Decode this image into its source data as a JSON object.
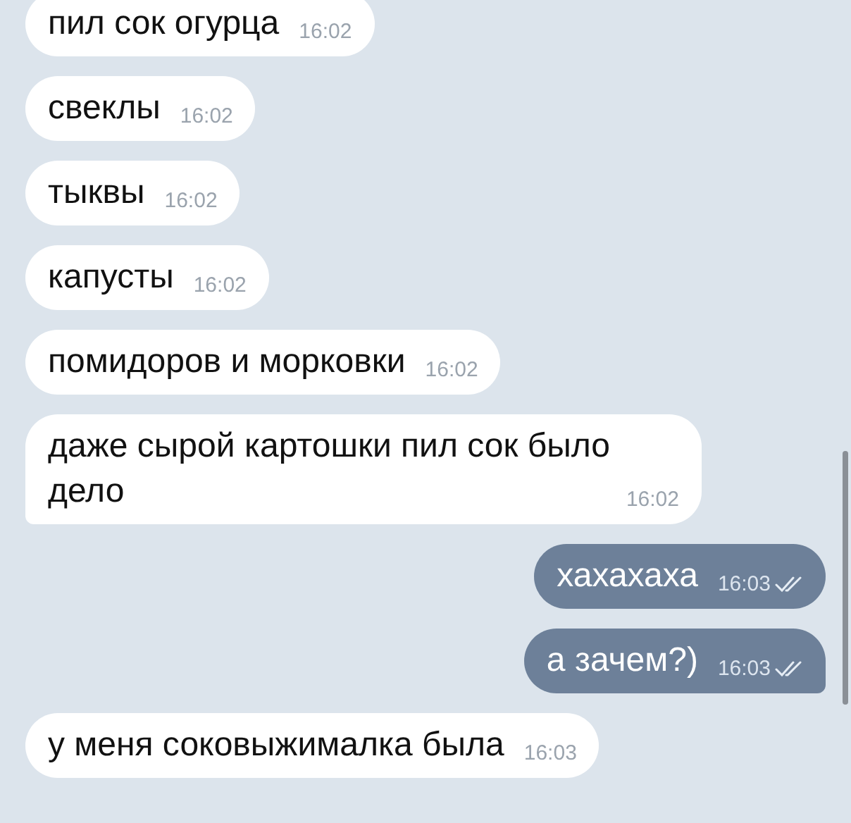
{
  "messages": [
    {
      "kind": "incoming",
      "text": "пил сок огурца",
      "time": "16:02",
      "tail": false
    },
    {
      "kind": "incoming",
      "text": "свеклы",
      "time": "16:02",
      "tail": false
    },
    {
      "kind": "incoming",
      "text": "тыквы",
      "time": "16:02",
      "tail": false
    },
    {
      "kind": "incoming",
      "text": "капусты",
      "time": "16:02",
      "tail": false
    },
    {
      "kind": "incoming",
      "text": "помидоров и морковки",
      "time": "16:02",
      "tail": false
    },
    {
      "kind": "incoming",
      "text": "даже сырой картошки пил сок было дело",
      "time": "16:02",
      "tail": true
    },
    {
      "kind": "outgoing",
      "text": "хахахаха",
      "time": "16:03",
      "read": true,
      "tail": false
    },
    {
      "kind": "outgoing",
      "text": "а зачем?)",
      "time": "16:03",
      "read": true,
      "tail": true
    },
    {
      "kind": "incoming",
      "text": "у меня соковыжималка была",
      "time": "16:03",
      "tail": false
    }
  ]
}
